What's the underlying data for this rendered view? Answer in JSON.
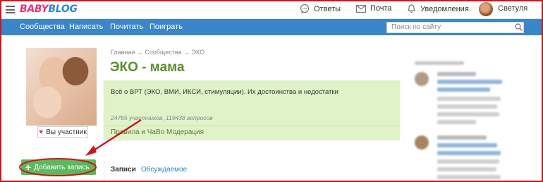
{
  "header": {
    "logo_part1": "BABY",
    "logo_part2": "BLOG",
    "nav": {
      "answers": "Ответы",
      "mail": "Почта",
      "notifications": "Уведомления",
      "user": "Светуля"
    }
  },
  "main_nav": {
    "items": [
      "Сообщества",
      "Написать",
      "Почитать",
      "Поиграть"
    ],
    "search_placeholder": "Поиск по сайту"
  },
  "community": {
    "breadcrumb": "Главная → Сообщества → ЭКО",
    "title": "ЭКО - мама",
    "description": "Всё о ВРТ (ЭКО, ВМИ, ИКСИ, стимуляции). Их достоинства и недостатки",
    "stats": "24765 участников, 119438 вопросов",
    "member_button": "Вы участник",
    "links": [
      "Правила и ЧаВо",
      "Модерация"
    ]
  },
  "actions": {
    "add_post": "Добавить запись"
  },
  "tabs": [
    "Записи",
    "Обсуждаемое"
  ],
  "colors": {
    "brand_pink": "#e5327a",
    "brand_blue": "#2d86d1",
    "nav_blue": "#3a86c8",
    "green_accent": "#5a8f29",
    "green_box": "#dff2c8",
    "button_green": "#5cb85c",
    "annotation_red": "#d0141c"
  }
}
